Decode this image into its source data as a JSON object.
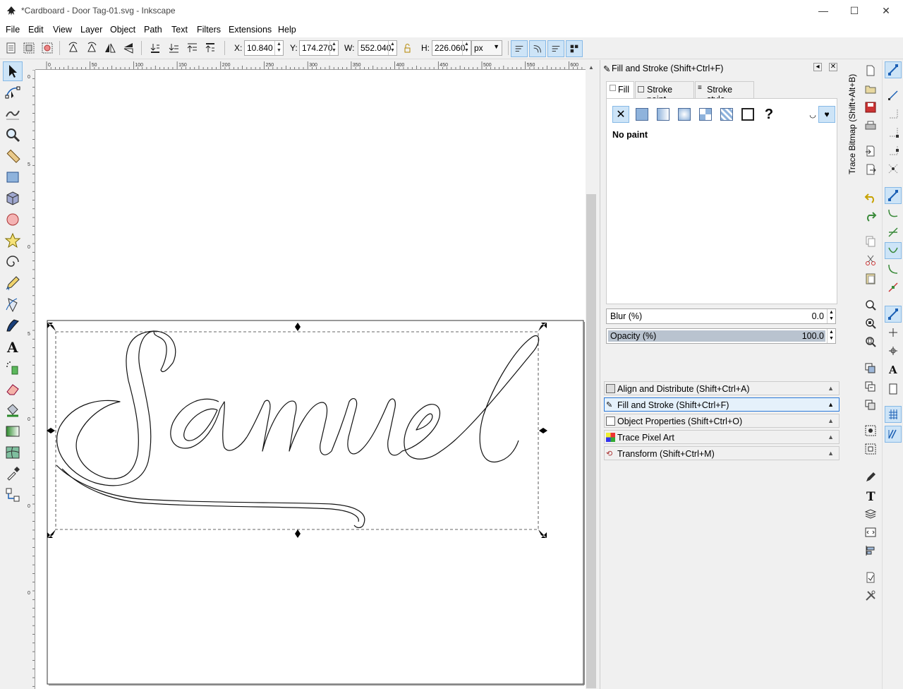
{
  "window": {
    "title": "*Cardboard - Door Tag-01.svg - Inkscape",
    "minimize": "—",
    "maximize": "☐",
    "close": "✕"
  },
  "menu": [
    "File",
    "Edit",
    "View",
    "Layer",
    "Object",
    "Path",
    "Text",
    "Filters",
    "Extensions",
    "Help"
  ],
  "toolbar": {
    "x_label": "X:",
    "x_value": "10.840",
    "y_label": "Y:",
    "y_value": "174.270",
    "w_label": "W:",
    "w_value": "552.040",
    "h_label": "H:",
    "h_value": "226.060",
    "unit": "px"
  },
  "ruler": {
    "h_ticks": [
      "0",
      "50",
      "100",
      "150",
      "200",
      "250",
      "300",
      "350",
      "400",
      "450",
      "500",
      "550",
      "600"
    ],
    "v_ticks": [
      "0",
      "5",
      "0",
      "5",
      "0",
      "0",
      "0"
    ]
  },
  "canvas": {
    "text": "Samuel"
  },
  "fill_stroke": {
    "title": "Fill and Stroke (Shift+Ctrl+F)",
    "tabs": [
      "Fill",
      "Stroke paint",
      "Stroke style"
    ],
    "paint_status": "No paint",
    "blur_label": "Blur (%)",
    "blur_value": "0.0",
    "opacity_label": "Opacity (%)",
    "opacity_value": "100.0",
    "opacity_fraction": 1.0
  },
  "dock_items": [
    "Align and Distribute (Shift+Ctrl+A)",
    "Fill and Stroke (Shift+Ctrl+F)",
    "Object Properties (Shift+Ctrl+O)",
    "Trace Pixel Art",
    "Transform (Shift+Ctrl+M)"
  ],
  "vertical_tab": "Trace Bitmap (Shift+Alt+B)",
  "colors": {
    "accent": "#2b79d8",
    "active_bg": "#cde4f7"
  }
}
